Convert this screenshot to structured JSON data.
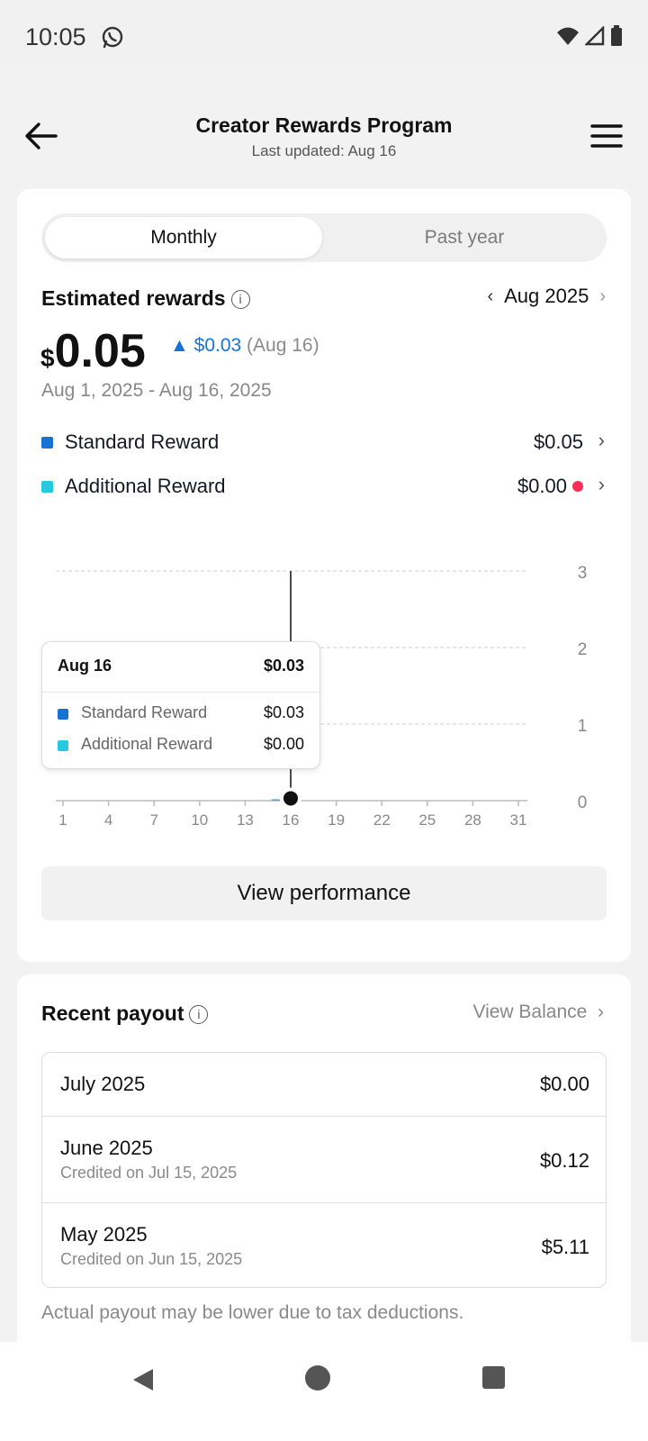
{
  "status": {
    "time": "10:05"
  },
  "header": {
    "title": "Creator Rewards Program",
    "subtitle": "Last updated: Aug 16"
  },
  "tabs": {
    "monthly": "Monthly",
    "past_year": "Past year",
    "active": "Monthly"
  },
  "estimated": {
    "label": "Estimated rewards",
    "month": "Aug 2025",
    "currency": "$",
    "amount": "0.05",
    "delta": "$0.03",
    "delta_date": "(Aug 16)",
    "range": "Aug 1, 2025 - Aug 16, 2025"
  },
  "legend": [
    {
      "label": "Standard Reward",
      "value": "$0.05",
      "color": "#1672d4"
    },
    {
      "label": "Additional Reward",
      "value": "$0.00",
      "color": "#25c9e0",
      "alert": true
    }
  ],
  "chart_data": {
    "type": "bar",
    "x_ticks": [
      "1",
      "4",
      "7",
      "10",
      "13",
      "16",
      "19",
      "22",
      "25",
      "28",
      "31"
    ],
    "y_ticks": [
      "0",
      "1",
      "2",
      "3"
    ],
    "ylim": [
      0,
      3
    ],
    "xlim": [
      1,
      31
    ],
    "series": [
      {
        "name": "Standard Reward",
        "color": "#1672d4",
        "values": [
          0,
          0,
          0,
          0,
          0,
          0,
          0,
          0,
          0,
          0,
          0,
          0,
          0,
          0,
          0.02,
          0.03
        ]
      },
      {
        "name": "Additional Reward",
        "color": "#25c9e0",
        "values": [
          0,
          0,
          0,
          0,
          0,
          0,
          0,
          0,
          0,
          0,
          0,
          0,
          0,
          0,
          0,
          0
        ]
      }
    ],
    "selected_day": 16
  },
  "tooltip": {
    "date": "Aug 16",
    "total": "$0.03",
    "rows": [
      {
        "label": "Standard Reward",
        "value": "$0.03",
        "color": "#1672d4"
      },
      {
        "label": "Additional Reward",
        "value": "$0.00",
        "color": "#25c9e0"
      }
    ]
  },
  "view_performance": "View performance",
  "recent_payout": {
    "label": "Recent payout",
    "view_balance": "View Balance",
    "items": [
      {
        "month": "July 2025",
        "credited": "",
        "amount": "$0.00"
      },
      {
        "month": "June 2025",
        "credited": "Credited on Jul 15, 2025",
        "amount": "$0.12"
      },
      {
        "month": "May 2025",
        "credited": "Credited on Jun 15, 2025",
        "amount": "$5.11"
      }
    ],
    "disclaimer": "Actual payout may be lower due to tax deductions."
  }
}
